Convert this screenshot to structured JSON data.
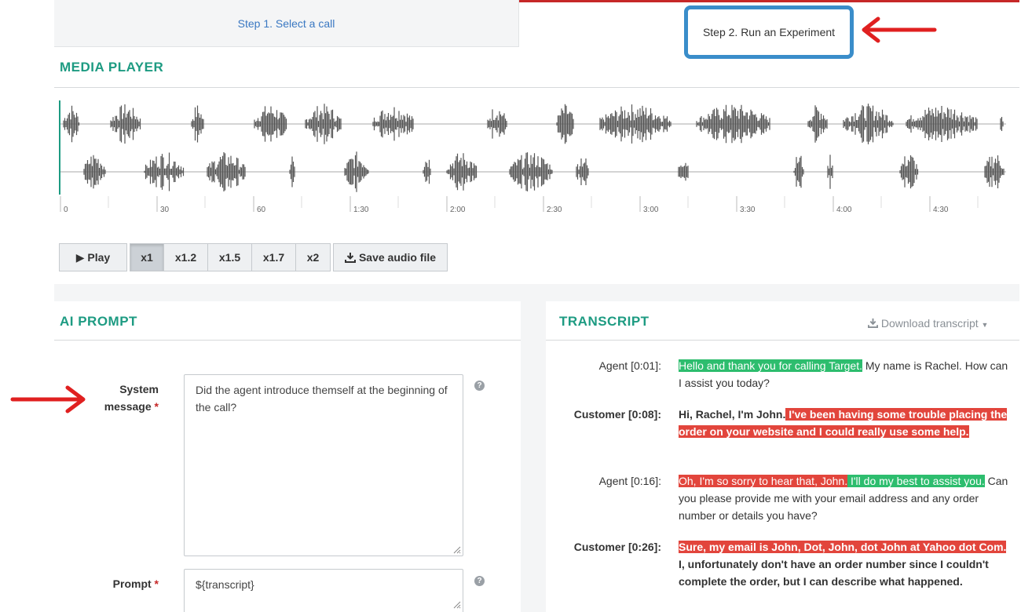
{
  "tabs": {
    "step1": "Step 1. Select a call",
    "step2": "Step 2. Run an Experiment"
  },
  "media_player": {
    "title": "MEDIA  PLAYER",
    "timeline_ticks": [
      "0",
      "30",
      "60",
      "1:30",
      "2:00",
      "2:30",
      "3:00",
      "3:30",
      "4:00",
      "4:30"
    ],
    "play_label": "▶ Play",
    "speeds": [
      "x1",
      "x1.2",
      "x1.5",
      "x1.7",
      "x2"
    ],
    "selected_speed": "x1",
    "save_label": "Save audio file"
  },
  "ai_prompt": {
    "title": "AI  PROMPT",
    "system_label_line1": "System",
    "system_label_line2": "message",
    "system_value": "Did the agent introduce themself at the beginning of the call?",
    "prompt_label": "Prompt",
    "prompt_value": "${transcript}",
    "required_mark": "*"
  },
  "transcript": {
    "title": "TRANSCRIPT",
    "download_label": "Download transcript",
    "entries": [
      {
        "speaker": "Agent [0:01]:"
      },
      {
        "speaker": "Customer [0:08]:"
      },
      {
        "speaker": "Agent [0:16]:"
      },
      {
        "speaker": "Customer [0:26]:"
      }
    ],
    "e0_g": "Hello and thank you for calling Target.",
    "e0_n": " My name is Rachel. How can I assist you today?",
    "e1_n": "Hi, Rachel, I'm John.",
    "e1_r": " I've been having some trouble placing the order on your website and I could really use some help.",
    "e2_r": "Oh, I'm so sorry to hear that, John.",
    "e2_g": " I'll do my best to assist you.",
    "e2_n": " Can you please provide me with your email address and any order number or details you have?",
    "e3_r": "Sure, my email is John, Dot, John, dot John at Yahoo dot Com.",
    "e3_n": " I, unfortunately don't have an order number since I couldn't complete the order, but I can describe what happened."
  },
  "colors": {
    "accent_green": "#1d9b82",
    "highlight_green": "#2dbd6e",
    "highlight_red": "#e2453c",
    "annotation_red": "#e02020",
    "annotation_blue": "#3a8dca",
    "link_blue": "#3a78c2"
  },
  "icons": {
    "play": "play-icon",
    "download": "download-icon",
    "help": "help-icon",
    "caret": "caret-down-icon"
  }
}
